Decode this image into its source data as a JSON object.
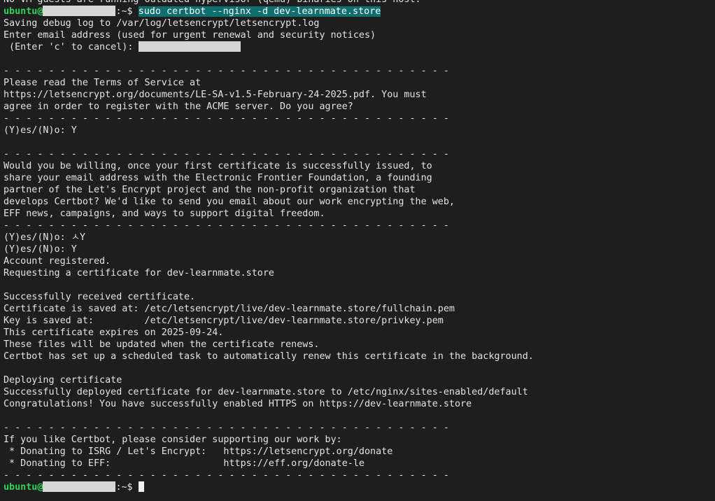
{
  "terminal": {
    "lines": [
      "No VM guests are running outdated hypervisor (qemu) binaries on this host.",
      "",
      "Saving debug log to /var/log/letsencrypt/letsencrypt.log",
      "Enter email address (used for urgent renewal and security notices)",
      "",
      "",
      "- - - - - - - - - - - - - - - - - - - - - - - - - - - - - - - - - - - - - - - -",
      "Please read the Terms of Service at",
      "https://letsencrypt.org/documents/LE-SA-v1.5-February-24-2025.pdf. You must",
      "agree in order to register with the ACME server. Do you agree?",
      "- - - - - - - - - - - - - - - - - - - - - - - - - - - - - - - - - - - - - - - -",
      "(Y)es/(N)o: Y",
      "",
      "- - - - - - - - - - - - - - - - - - - - - - - - - - - - - - - - - - - - - - - -",
      "Would you be willing, once your first certificate is successfully issued, to",
      "share your email address with the Electronic Frontier Foundation, a founding",
      "partner of the Let's Encrypt project and the non-profit organization that",
      "develops Certbot? We'd like to send you email about our work encrypting the web,",
      "EFF news, campaigns, and ways to support digital freedom.",
      "- - - - - - - - - - - - - - - - - - - - - - - - - - - - - - - - - - - - - - - -",
      "(Y)es/(N)o: ㅅY",
      "(Y)es/(N)o: Y",
      "Account registered.",
      "Requesting a certificate for dev-learnmate.store",
      "",
      "Successfully received certificate.",
      "Certificate is saved at: /etc/letsencrypt/live/dev-learnmate.store/fullchain.pem",
      "Key is saved at:         /etc/letsencrypt/live/dev-learnmate.store/privkey.pem",
      "This certificate expires on 2025-09-24.",
      "These files will be updated when the certificate renews.",
      "Certbot has set up a scheduled task to automatically renew this certificate in the background.",
      "",
      "Deploying certificate",
      "Successfully deployed certificate for dev-learnmate.store to /etc/nginx/sites-enabled/default",
      "Congratulations! You have successfully enabled HTTPS on https://dev-learnmate.store",
      "",
      "- - - - - - - - - - - - - - - - - - - - - - - - - - - - - - - - - - - - - - - -",
      "If you like Certbot, please consider supporting our work by:",
      " * Donating to ISRG / Let's Encrypt:   https://letsencrypt.org/donate",
      " * Donating to EFF:                    https://eff.org/donate-le",
      "- - - - - - - - - - - - - - - - - - - - - - - - - - - - - - - - - - - - - - - -",
      ""
    ],
    "prompt_user": "ubuntu@",
    "prompt_suffix": ":~$ ",
    "command": "sudo certbot --nginx -d dev-learnmate.store",
    "email_prompt": " (Enter 'c' to cancel): "
  }
}
